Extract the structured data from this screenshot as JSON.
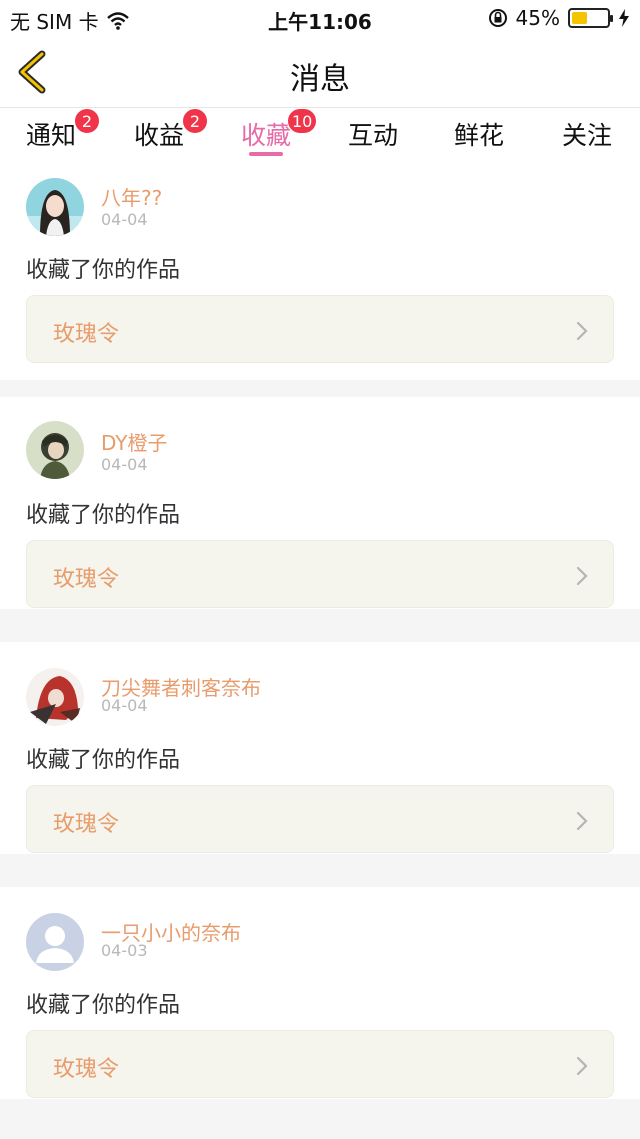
{
  "status_bar": {
    "carrier": "无 SIM 卡",
    "time": "上午11:06",
    "battery_percent": "45%",
    "battery_level": 0.45
  },
  "nav": {
    "title": "消息"
  },
  "tabs": [
    {
      "label": "通知",
      "badge": "2"
    },
    {
      "label": "收益",
      "badge": "2"
    },
    {
      "label": "收藏",
      "badge": "10",
      "active": true
    },
    {
      "label": "互动"
    },
    {
      "label": "鲜花"
    },
    {
      "label": "关注"
    }
  ],
  "colors": {
    "accent": "#e86aa7",
    "badge": "#f0354a",
    "username": "#e89c6c"
  },
  "items": [
    {
      "username": "八年??",
      "date": "04-04",
      "action": "收藏了你的作品",
      "work": "玫瑰令",
      "avatar": "girl-photo-avatar"
    },
    {
      "username": "DY橙子",
      "date": "04-04",
      "action": "收藏了你的作品",
      "work": "玫瑰令",
      "avatar": "anime-boy-avatar"
    },
    {
      "username": "刀尖舞者刺客奈布",
      "date": "04-04",
      "action": "收藏了你的作品",
      "work": "玫瑰令",
      "avatar": "assassin-character-avatar"
    },
    {
      "username": "一只小小的奈布",
      "date": "04-03",
      "action": "收藏了你的作品",
      "work": "玫瑰令",
      "avatar": "default-user-avatar"
    }
  ]
}
